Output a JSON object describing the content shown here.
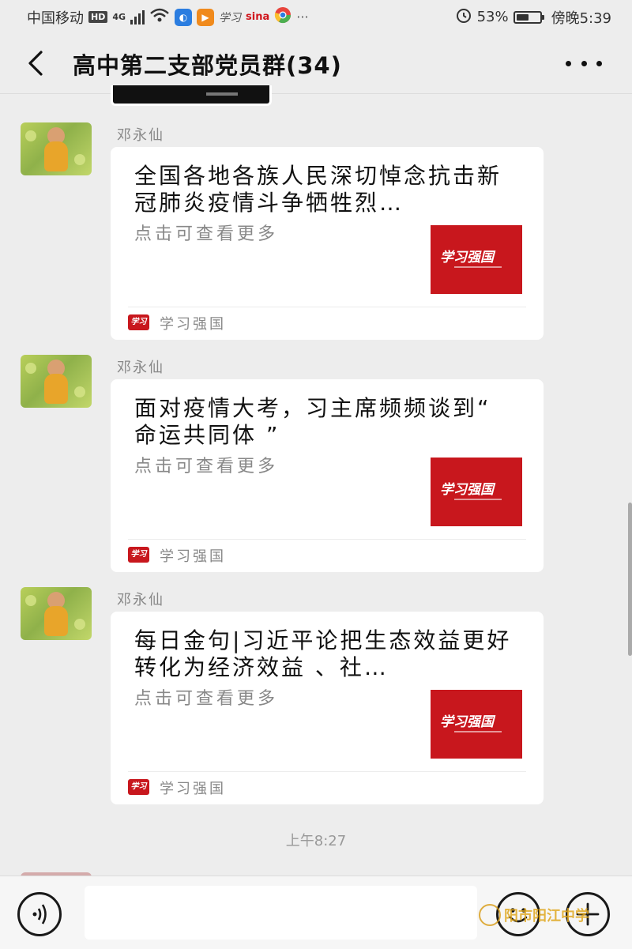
{
  "status_bar": {
    "carrier": "中国移动",
    "hd": "HD",
    "network": "4G",
    "battery_percent": "53%",
    "time": "傍晚5:39",
    "battery_level": 0.53,
    "notification_icons": [
      "hd-icon",
      "signal-icon",
      "wifi-icon",
      "bluetooth-app-icon",
      "video-app-icon",
      "xuexi-app-icon",
      "sina-weibo-icon",
      "chrome-icon",
      "more-dots-icon"
    ]
  },
  "header": {
    "title": "高中第二支部党员群(34)",
    "back_icon": "chevron-left-icon",
    "more_icon": "more-dots-icon"
  },
  "messages": [
    {
      "sender": "邓永仙",
      "title": "全国各地各族人民深切悼念抗击新冠肺炎疫情斗争牺牲烈…",
      "desc": "点击可查看更多",
      "source": "学习强国",
      "thumb_text": "学习强国"
    },
    {
      "sender": "邓永仙",
      "title": "面对疫情大考，习主席频频谈到“ 命运共同体 ”",
      "desc": "点击可查看更多",
      "source": "学习强国",
      "thumb_text": "学习强国"
    },
    {
      "sender": "邓永仙",
      "title": "每日金句|习近平论把生态效益更好转化为经济效益 、社…",
      "desc": "点击可查看更多",
      "source": "学习强国",
      "thumb_text": "学习强国"
    }
  ],
  "timestamp": "上午8:27",
  "input_bar": {
    "placeholder": "",
    "voice_icon": "voice-icon",
    "emoji_icon": "emoji-icon",
    "plus_icon": "plus-icon"
  },
  "watermark": {
    "text": "阳市阳江中学"
  },
  "colors": {
    "background": "#ededed",
    "card": "#ffffff",
    "xuexi_red": "#c8171d"
  }
}
